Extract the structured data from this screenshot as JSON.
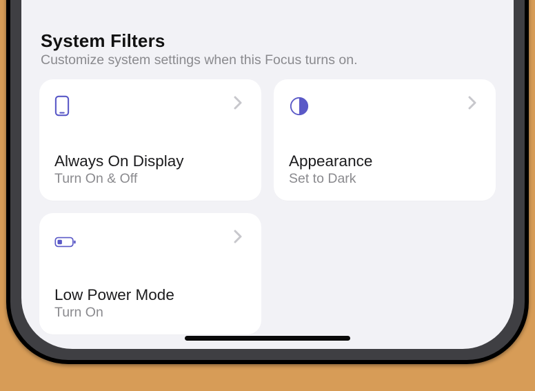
{
  "colors": {
    "accent": "#5a59c7"
  },
  "section": {
    "title": "System Filters",
    "subtitle": "Customize system settings when this Focus turns on."
  },
  "cards": [
    {
      "icon": "phone-icon",
      "title": "Always On Display",
      "subtitle": "Turn On & Off"
    },
    {
      "icon": "half-circle-icon",
      "title": "Appearance",
      "subtitle": "Set to Dark"
    },
    {
      "icon": "battery-icon",
      "title": "Low Power Mode",
      "subtitle": "Turn On"
    }
  ]
}
